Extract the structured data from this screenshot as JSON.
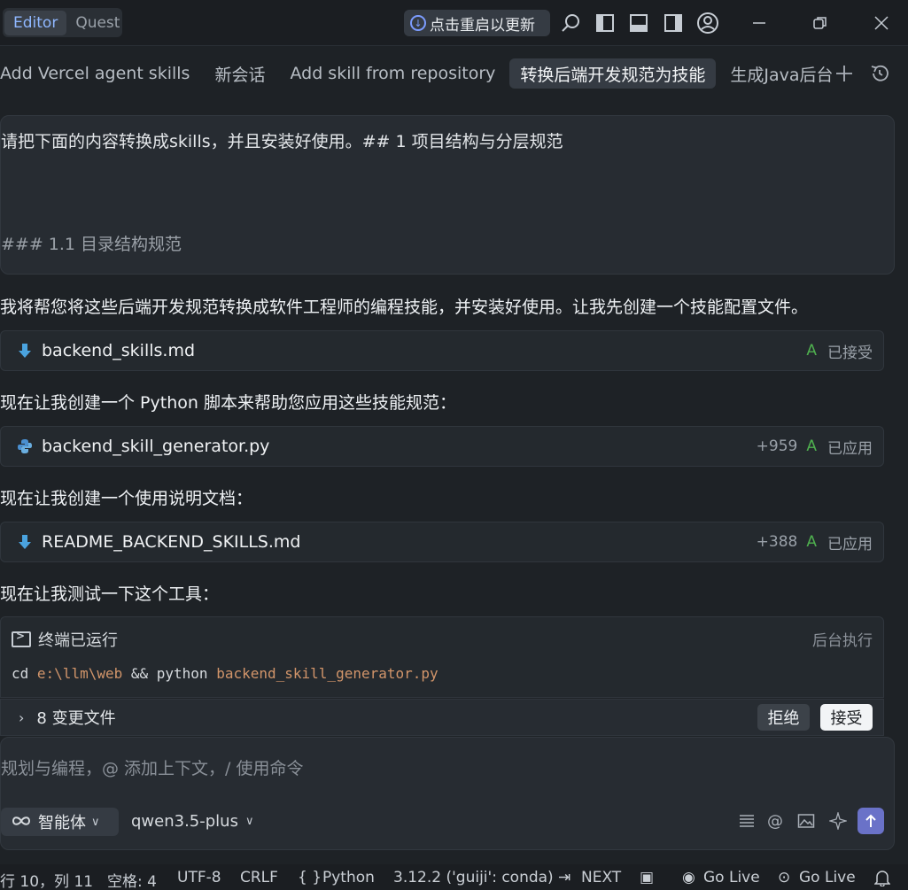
{
  "titlebar": {
    "mode_editor": "Editor",
    "mode_quest": "Quest",
    "update_label": "点击重启以更新"
  },
  "tabs": [
    {
      "label": "Add Vercel agent skills"
    },
    {
      "label": "新会话"
    },
    {
      "label": "Add skill from repository"
    },
    {
      "label": "转换后端开发规范为技能"
    },
    {
      "label": "生成Java后台"
    }
  ],
  "prompt": {
    "line1": "请把下面的内容转换成skills，并且安装好使用。## 1 项目结构与分层规范",
    "line2": "### 1.1 目录结构规范"
  },
  "messages": {
    "m1": "我将帮您将这些后端开发规范转换成软件工程师的编程技能，并安装好使用。让我先创建一个技能配置文件。",
    "m2": "现在让我创建一个 Python 脚本来帮助您应用这些技能规范：",
    "m3": "现在让我创建一个使用说明文档：",
    "m4": "现在让我测试一下这个工具："
  },
  "files": [
    {
      "name": "backend_skills.md",
      "diff": "",
      "badge": "A",
      "status": "已接受"
    },
    {
      "name": "backend_skill_generator.py",
      "diff": "+959",
      "badge": "A",
      "status": "已应用"
    },
    {
      "name": "README_BACKEND_SKILLS.md",
      "diff": "+388",
      "badge": "A",
      "status": "已应用"
    }
  ],
  "terminal": {
    "title": "终端已运行",
    "bg_label": "后台执行",
    "cmd_prefix": "cd ",
    "cmd_path": "e:\\llm\\web",
    "cmd_mid": " && python ",
    "cmd_file": "backend_skill_generator.py"
  },
  "changes": {
    "label": "8 变更文件",
    "reject": "拒绝",
    "accept": "接受"
  },
  "input": {
    "placeholder": "规划与编程，@ 添加上下文，/ 使用命令",
    "agent_label": "智能体",
    "model_label": "qwen3.5-plus"
  },
  "statusbar": {
    "position": "行 10，列 11",
    "spaces": "空格: 4",
    "encoding": "UTF-8",
    "eol": "CRLF",
    "language": "Python",
    "interpreter": "3.12.2 ('guiji': conda)",
    "next": "NEXT",
    "golive1": "Go Live",
    "golive2": "Go Live"
  },
  "colors": {
    "accent": "#8fb7ff",
    "send": "#6a72c8",
    "added": "#4fb04f",
    "path": "#d2956a"
  }
}
